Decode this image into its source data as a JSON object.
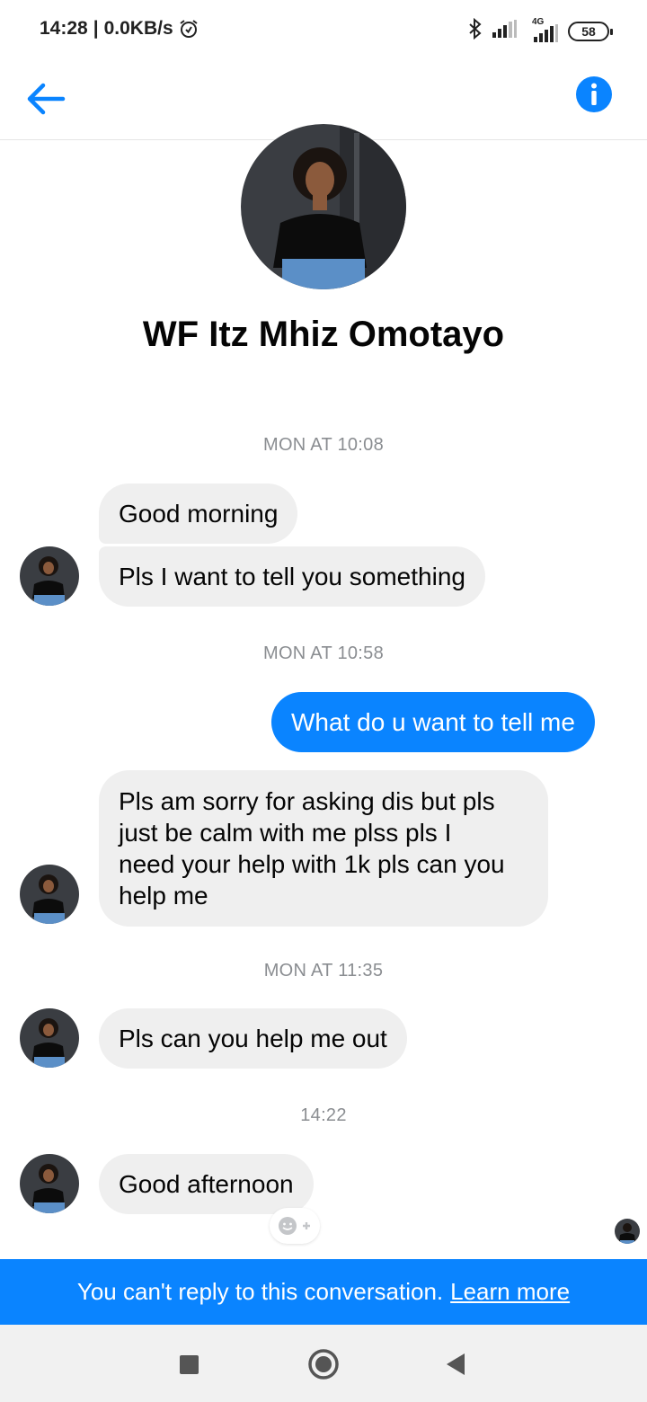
{
  "status_bar": {
    "time": "14:28",
    "separator": "|",
    "network_speed": "0.0KB/s",
    "network_type": "4G",
    "battery": "58",
    "icons": [
      "alarm-icon",
      "bluetooth-icon",
      "signal-icon",
      "signal-4g-icon",
      "battery-icon"
    ]
  },
  "header": {
    "back_icon": "arrow-left-icon",
    "info_icon": "info-icon",
    "accent_color": "#0a84ff"
  },
  "profile": {
    "name": "WF Itz Mhiz Omotayo"
  },
  "messages": [
    {
      "type": "timestamp",
      "text": "MON AT 10:08"
    },
    {
      "type": "incoming",
      "text": "Good morning"
    },
    {
      "type": "incoming",
      "text": "Pls I want to tell you something"
    },
    {
      "type": "timestamp",
      "text": "MON AT 10:58"
    },
    {
      "type": "outgoing",
      "text": "What do u want to tell me"
    },
    {
      "type": "incoming",
      "lines": [
        "Pls am sorry for asking dis but pls",
        "just be calm with me plss pls I",
        "need your help with 1k pls can you",
        "help me"
      ]
    },
    {
      "type": "timestamp",
      "text": "MON AT 11:35"
    },
    {
      "type": "incoming",
      "text": "Pls can you help me out"
    },
    {
      "type": "timestamp",
      "text": "14:22"
    },
    {
      "type": "incoming",
      "text": "Good afternoon"
    }
  ],
  "reaction_button": {
    "icon": "add-reaction-icon"
  },
  "banner": {
    "text": "You can't reply to this conversation.",
    "link": "Learn more",
    "background": "#0a84ff"
  },
  "nav": {
    "icons": [
      "recents-square-icon",
      "home-circle-icon",
      "back-triangle-icon"
    ]
  }
}
